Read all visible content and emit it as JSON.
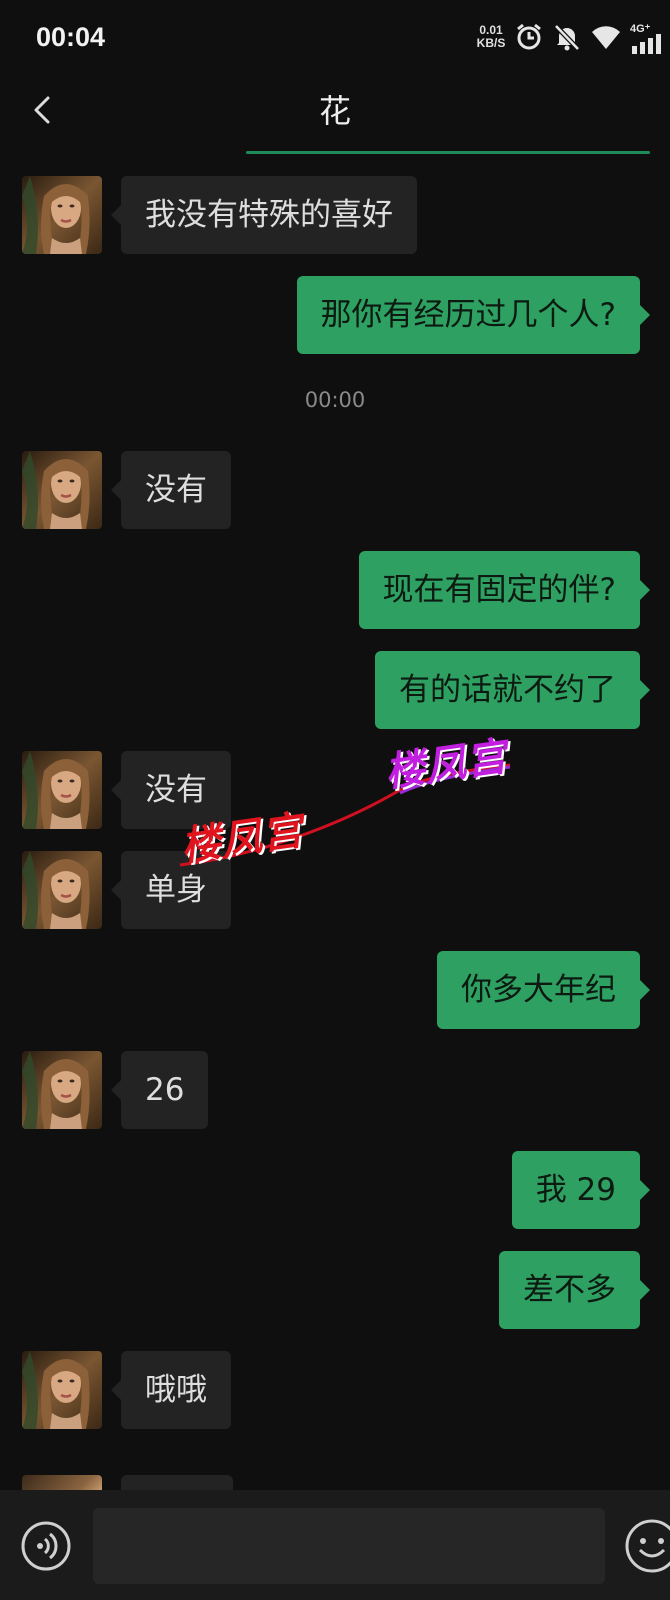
{
  "status_bar": {
    "time": "00:04",
    "net_speed_value": "0.01",
    "net_speed_unit": "KB/S",
    "network_type": "4G⁺",
    "icons": [
      "alarm-icon",
      "mute-icon",
      "wifi-icon",
      "signal-icon"
    ]
  },
  "header": {
    "title": "花",
    "back_icon": "chevron-left-icon"
  },
  "messages": [
    {
      "side": "in",
      "text": "我没有特殊的喜好"
    },
    {
      "side": "out",
      "text": "那你有经历过几个人?"
    },
    {
      "type": "timestamp",
      "text": "00:00"
    },
    {
      "side": "in",
      "text": "没有"
    },
    {
      "side": "out",
      "text": "现在有固定的伴?"
    },
    {
      "side": "out",
      "text": "有的话就不约了"
    },
    {
      "side": "in",
      "text": "没有"
    },
    {
      "side": "in",
      "text": "单身"
    },
    {
      "side": "out",
      "text": "你多大年纪"
    },
    {
      "side": "in",
      "text": "26"
    },
    {
      "side": "out",
      "text": "我 29"
    },
    {
      "side": "out",
      "text": "差不多"
    },
    {
      "side": "in",
      "text": "哦哦"
    }
  ],
  "watermark": {
    "text_red": "楼凤宫",
    "text_purple": "楼凤宫"
  },
  "input_bar": {
    "voice_icon": "voice-icon",
    "input_value": "",
    "emoji_icon": "emoji-icon"
  },
  "colors": {
    "outgoing": "#2ea162",
    "incoming": "#232323",
    "background": "#0f0f0f",
    "accent": "#1e8a57"
  }
}
